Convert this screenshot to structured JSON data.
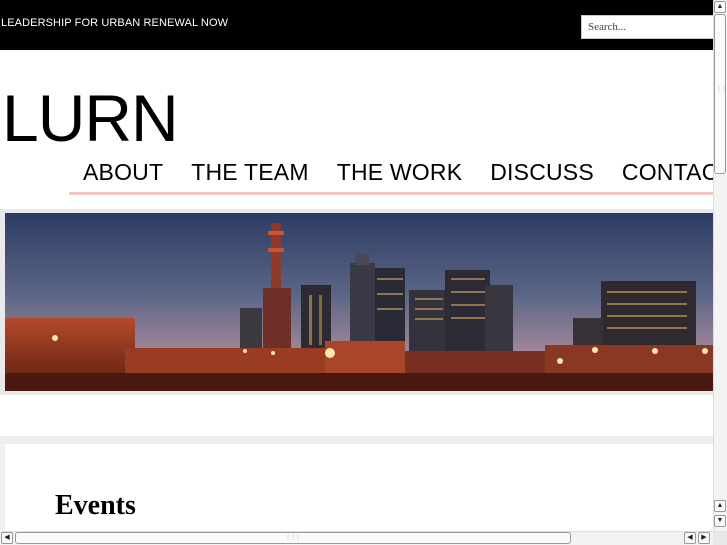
{
  "header": {
    "tagline": "LEADERSHIP FOR URBAN RENEWAL NOW",
    "search_placeholder": "Search..."
  },
  "site": {
    "logo": "LURN"
  },
  "nav": {
    "items": [
      {
        "label": "ABOUT"
      },
      {
        "label": "THE TEAM"
      },
      {
        "label": "THE WORK"
      },
      {
        "label": "DISCUSS"
      },
      {
        "label": "CONTACT"
      }
    ]
  },
  "main": {
    "heading": "Events"
  },
  "icons": {
    "up_arrow": "▲",
    "down_arrow": "▼",
    "left_arrow": "◀",
    "right_arrow": "▶"
  },
  "colors": {
    "topbar": "#000000",
    "nav_underline": "#f4c7c7"
  }
}
